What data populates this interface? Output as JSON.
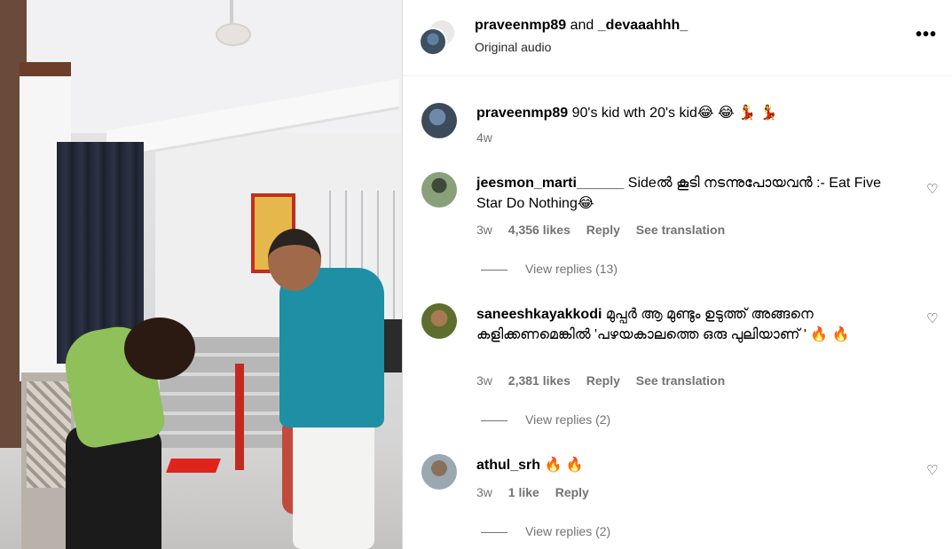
{
  "header": {
    "user1": "praveenmp89",
    "and": "and",
    "user2": "_devaaahhh_",
    "audio": "Original audio",
    "more_icon": "more-horizontal-icon"
  },
  "caption": {
    "user": "praveenmp89",
    "text": "90's kid wth 20's kid😂 😂 💃 💃",
    "time": "4w"
  },
  "comments": [
    {
      "user": "jeesmon_marti______",
      "text": "Sideൽ കൂടി നടന്നുപോയവൻ :- Eat Five Star Do Nothing😂",
      "time": "3w",
      "likes": "4,356 likes",
      "reply": "Reply",
      "translate": "See translation",
      "view_replies": "View replies (13)"
    },
    {
      "user": "saneeshkayakkodi",
      "text": "മുപ്പർ ആ മുണ്ടും ഉടുത്ത് അങ്ങനെ കളിക്കണമെങ്കിൽ 'പഴയകാലത്തെ ഒരു പുലിയാണ് ' 🔥 🔥",
      "time": "3w",
      "likes": "2,381 likes",
      "reply": "Reply",
      "translate": "See translation",
      "view_replies": "View replies (2)"
    },
    {
      "user": "athul_srh",
      "text": "🔥 🔥",
      "time": "3w",
      "likes": "1 like",
      "reply": "Reply",
      "view_replies": "View replies (2)"
    }
  ]
}
